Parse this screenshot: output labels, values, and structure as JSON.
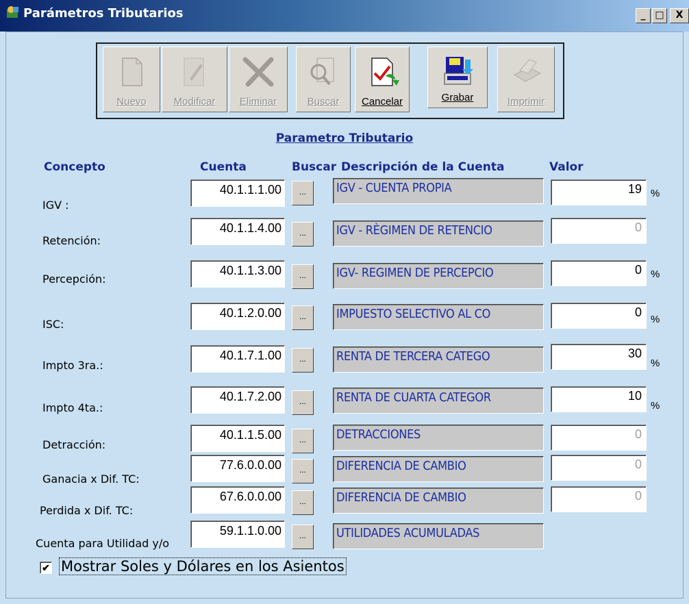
{
  "window": {
    "title": "Parámetros Tributarios",
    "controls": [
      "_",
      "□",
      "X"
    ]
  },
  "toolbar": {
    "buttons": [
      {
        "label": "Nuevo",
        "enabled": false,
        "icon": "new-document-icon"
      },
      {
        "label": "Modificar",
        "enabled": false,
        "icon": "edit-pencil-icon"
      },
      {
        "label": "Eliminar",
        "enabled": false,
        "icon": "delete-x-icon"
      },
      {
        "label": "Buscar",
        "enabled": false,
        "icon": "search-magnifier-icon"
      },
      {
        "label": "Cancelar",
        "enabled": true,
        "icon": "cancel-check-icon"
      },
      {
        "label": "Grabar",
        "enabled": true,
        "icon": "save-floppy-icon"
      },
      {
        "label": "Imprimir",
        "enabled": false,
        "icon": "print-icon"
      }
    ]
  },
  "section_title": "Parametro Tributario",
  "headers": {
    "concepto": "Concepto",
    "cuenta": "Cuenta",
    "buscar": "Buscar",
    "descripcion": "Descripción de la Cuenta",
    "valor": "Valor"
  },
  "rows": [
    {
      "label": "IGV :",
      "cuenta": "40.1.1.1.00",
      "buscar": "...",
      "descripcion": "IGV - CUENTA PROPIA",
      "valor": "19",
      "valor_enabled": true,
      "pct": "%"
    },
    {
      "label": "Retención:",
      "cuenta": "40.1.1.4.00",
      "buscar": "...",
      "descripcion": "IGV - RÈGIMEN DE RETENCIO",
      "valor": "0",
      "valor_enabled": false,
      "pct": ""
    },
    {
      "label": "Percepción:",
      "cuenta": "40.1.1.3.00",
      "buscar": "...",
      "descripcion": "IGV- REGIMEN DE  PERCEPCIO",
      "valor": "0",
      "valor_enabled": true,
      "pct": "%"
    },
    {
      "label": "ISC:",
      "cuenta": "40.1.2.0.00",
      "buscar": "...",
      "descripcion": "IMPUESTO SELECTIVO AL CO",
      "valor": "0",
      "valor_enabled": true,
      "pct": "%"
    },
    {
      "label": "Impto 3ra.:",
      "cuenta": "40.1.7.1.00",
      "buscar": "...",
      "descripcion": "RENTA DE TERCERA CATEGO",
      "valor": "30",
      "valor_enabled": true,
      "pct": "%"
    },
    {
      "label": "Impto 4ta.:",
      "cuenta": "40.1.7.2.00",
      "buscar": "...",
      "descripcion": "RENTA DE CUARTA CATEGOR",
      "valor": "10",
      "valor_enabled": true,
      "pct": "%"
    },
    {
      "label": "Detracción:",
      "cuenta": "40.1.1.5.00",
      "buscar": "...",
      "descripcion": "DETRACCIONES",
      "valor": "0",
      "valor_enabled": false,
      "pct": ""
    },
    {
      "label": "Ganacia x Dif. TC:",
      "cuenta": "77.6.0.0.00",
      "buscar": "...",
      "descripcion": "DIFERENCIA DE CAMBIO",
      "valor": "0",
      "valor_enabled": false,
      "pct": ""
    },
    {
      "label": "Perdida x Dif. TC:",
      "cuenta": "67.6.0.0.00",
      "buscar": "...",
      "descripcion": "DIFERENCIA DE CAMBIO",
      "valor": "0",
      "valor_enabled": false,
      "pct": ""
    },
    {
      "label": "Cuenta para Utilidad y/o",
      "cuenta": "59.1.1.0.00",
      "buscar": "...",
      "descripcion": "UTILIDADES ACUMULADAS",
      "valor": null,
      "valor_enabled": false,
      "pct": ""
    }
  ],
  "checkbox": {
    "label": "Mostrar Soles y Dólares en los Asientos",
    "checked": true
  }
}
